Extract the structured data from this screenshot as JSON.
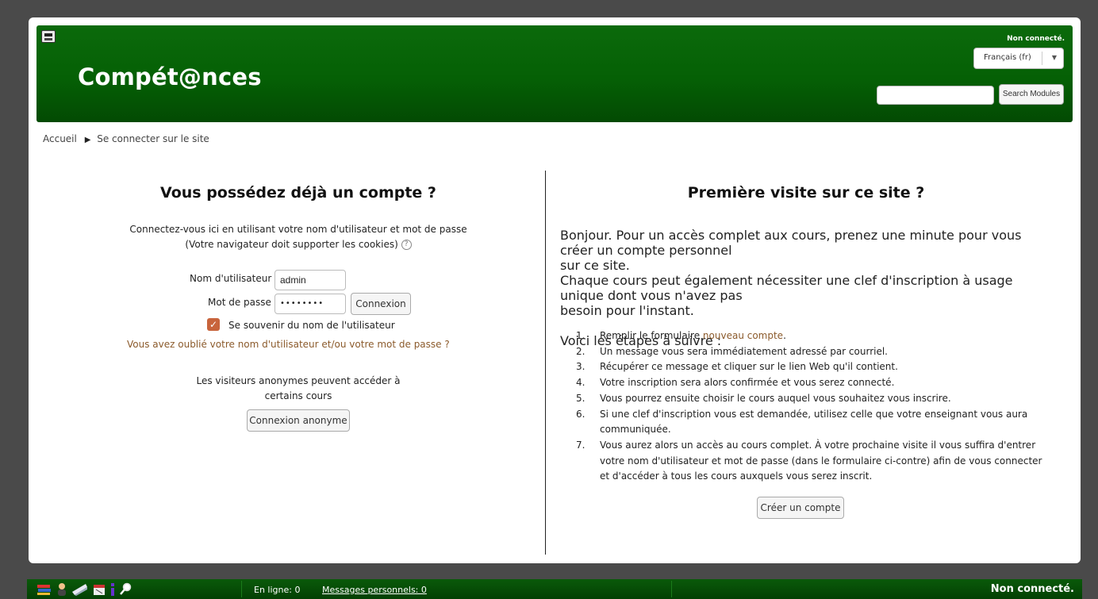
{
  "header": {
    "site_title": "Compét@nces",
    "login_status": "Non connecté.",
    "language": "Français (fr)",
    "search_placeholder": "",
    "search_button": "Search Modules"
  },
  "breadcrumb": {
    "home": "Accueil",
    "current": "Se connecter sur le site"
  },
  "login": {
    "heading": "Vous possédez déjà un compte ?",
    "intro_line1": "Connectez-vous ici en utilisant votre nom d'utilisateur et mot de passe",
    "intro_line2": "(Votre navigateur doit supporter les cookies)",
    "username_label": "Nom d'utilisateur",
    "username_value": "admin",
    "password_label": "Mot de passe",
    "password_value": "••••••••",
    "login_button": "Connexion",
    "remember_label": "Se souvenir du nom de l'utilisateur",
    "remember_checked": true,
    "forgot_link": "Vous avez oublié votre nom d'utilisateur et/ou votre mot de passe ?",
    "guest_line1": "Les visiteurs anonymes peuvent accéder à",
    "guest_line2": "certains cours",
    "guest_button": "Connexion anonyme"
  },
  "signup": {
    "heading": "Première visite sur ce site ?",
    "para1_line1": "Bonjour. Pour un accès complet aux cours, prenez une minute pour vous créer un compte personnel",
    "para1_line2": "sur ce site.",
    "para2_line1": "Chaque cours peut également nécessiter une clef d'inscription à usage unique dont vous n'avez pas",
    "para2_line2": "besoin pour l'instant.",
    "steps_intro": "Voici les étapes à suivre :",
    "step1_prefix": "Remplir le formulaire",
    "step1_link": "nouveau compte",
    "step1_suffix": ".",
    "step2": "Un message vous sera immédiatement adressé par courriel.",
    "step3": "Récupérer ce message et cliquer sur le lien Web qu'il contient.",
    "step4": "Votre inscription sera alors confirmée et vous serez connecté.",
    "step5": "Vous pourrez ensuite choisir le cours auquel vous souhaitez vous inscrire.",
    "step6_line1": "Si une clef d'inscription vous est demandée, utilisez celle que votre enseignant vous aura",
    "step6_line2": "communiquée.",
    "step7_line1": "Vous aurez alors un accès au cours complet. À votre prochaine visite il vous suffira d'entrer",
    "step7_line2": "votre nom d'utilisateur et mot de passe (dans le formulaire ci-contre) afin de vous connecter",
    "step7_line3": "et d'accéder à tous les cours auxquels vous serez inscrit.",
    "create_button": "Créer un compte",
    "numbers": [
      "1.",
      "2.",
      "3.",
      "4.",
      "5.",
      "6.",
      "7."
    ]
  },
  "footer": {
    "online": "En ligne: 0",
    "messages": "Messages personnels: 0",
    "status": "Non connecté.",
    "icons": [
      "books-icon",
      "user-icon",
      "mail-icon",
      "calendar-icon",
      "info-icon",
      "search-icon"
    ]
  },
  "colors": {
    "header_green": "#056005",
    "accent": "#c8643c",
    "link": "#8b5a2b"
  }
}
